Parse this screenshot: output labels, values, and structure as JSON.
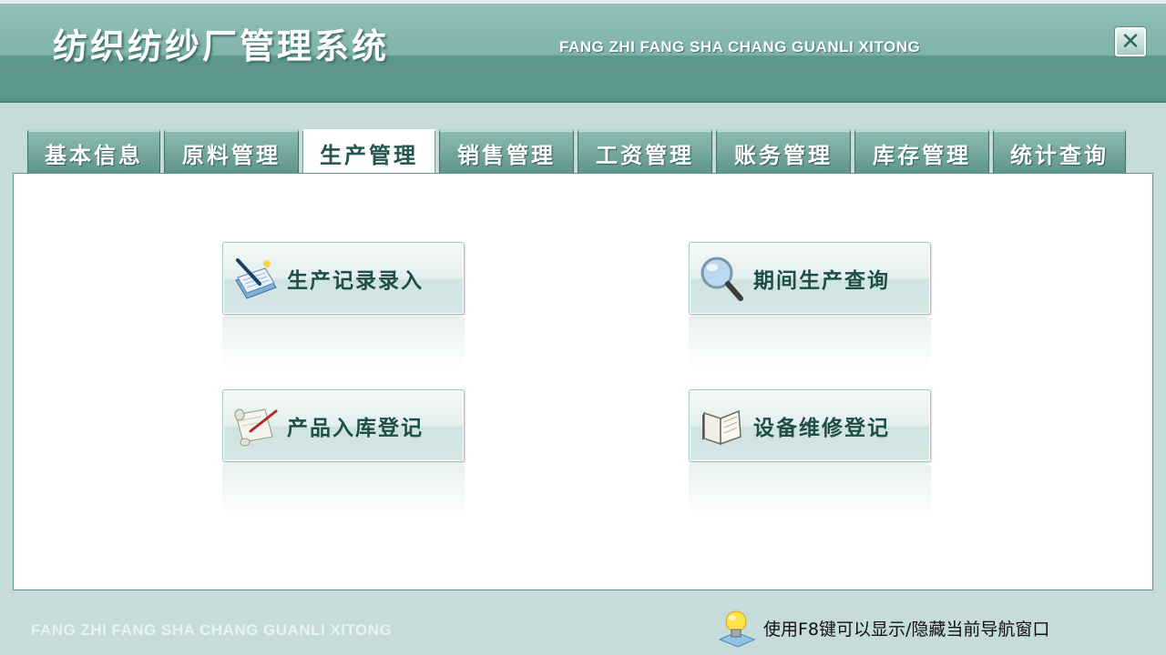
{
  "header": {
    "title": "纺织纺纱厂管理系统",
    "subtitle": "FANG ZHI FANG SHA CHANG GUANLI XITONG",
    "close_icon": "close-x-icon"
  },
  "tabs": [
    {
      "label": "基本信息",
      "active": false
    },
    {
      "label": "原料管理",
      "active": false
    },
    {
      "label": "生产管理",
      "active": true
    },
    {
      "label": "销售管理",
      "active": false
    },
    {
      "label": "工资管理",
      "active": false
    },
    {
      "label": "账务管理",
      "active": false
    },
    {
      "label": "库存管理",
      "active": false
    },
    {
      "label": "统计查询",
      "active": false
    }
  ],
  "actions": [
    {
      "label": "生产记录录入",
      "icon": "notebook-pen-icon"
    },
    {
      "label": "期间生产查询",
      "icon": "magnifier-icon"
    },
    {
      "label": "产品入库登记",
      "icon": "scroll-quill-icon"
    },
    {
      "label": "设备维修登记",
      "icon": "open-book-icon"
    }
  ],
  "footer": {
    "brand_text": "FANG ZHI FANG SHA CHANG GUANLI XITONG",
    "hint_text": "使用F8键可以显示/隐藏当前导航窗口",
    "hint_icon": "lightbulb-icon"
  },
  "colors": {
    "header_teal": "#5e978e",
    "tab_teal": "#6fa39b",
    "background": "#c5dcda",
    "label_dark": "#1f4e49"
  }
}
